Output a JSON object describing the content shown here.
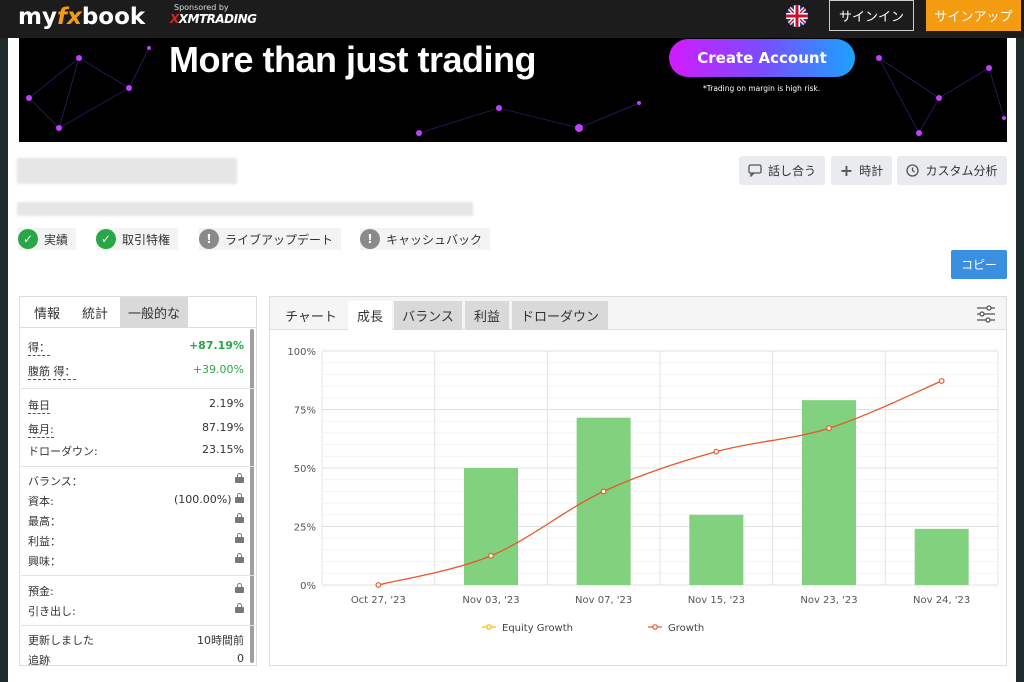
{
  "topbar": {
    "logo_pre": "my",
    "logo_fx": "fx",
    "logo_post": "book",
    "sponsor_label": "Sponsored by",
    "sponsor_brand_x": "X",
    "sponsor_brand": "XMTRADING",
    "signin": "サインイン",
    "signup": "サインアップ"
  },
  "banner": {
    "title": "More than just trading",
    "cta": "Create Account",
    "risk": "*Trading on margin is high risk."
  },
  "actions": {
    "discuss": "話し合う",
    "watch": "時計",
    "custom": "カスタム分析",
    "copy": "コピー"
  },
  "badges": [
    {
      "label": "実績",
      "status": "ok"
    },
    {
      "label": "取引特権",
      "status": "ok"
    },
    {
      "label": "ライブアップデート",
      "status": "warn"
    },
    {
      "label": "キャッシュバック",
      "status": "warn"
    }
  ],
  "stats_tabs": [
    "情報",
    "統計",
    "一般的な"
  ],
  "stats": {
    "gain_label": "得：",
    "gain": "+87.19%",
    "abs_gain_label": "腹筋 得：",
    "abs_gain": "+39.00%",
    "daily_label": "毎日",
    "daily": "2.19%",
    "monthly_label": "毎月:",
    "monthly": "87.19%",
    "drawdown_label": "ドローダウン:",
    "drawdown": "23.15%",
    "balance_label": "バランス：",
    "equity_label": "資本:",
    "equity": "(100.00%)",
    "highest_label": "最高：",
    "profit_label": "利益：",
    "interest_label": "興味：",
    "deposits_label": "預金:",
    "withdrawals_label": "引き出し:",
    "updated_label": "更新しました",
    "updated": "10時間前",
    "tracking_label": "追跡",
    "tracking": "0"
  },
  "chart_tabs": [
    "チャート",
    "成長",
    "バランス",
    "利益",
    "ドローダウン"
  ],
  "chart_data": {
    "type": "bar",
    "categories": [
      "Oct 27, '23",
      "Nov 03, '23",
      "Nov 07, '23",
      "Nov 15, '23",
      "Nov 23, '23",
      "Nov 24, '23"
    ],
    "y_ticks": [
      "0%",
      "25%",
      "50%",
      "75%",
      "100%"
    ],
    "ylim": [
      0,
      100
    ],
    "series": [
      {
        "name": "Equity Growth",
        "type": "line",
        "color": "#f5b800",
        "values": []
      },
      {
        "name": "Growth",
        "type": "line",
        "color": "#e8562a",
        "values": [
          0,
          12.5,
          40,
          57,
          67,
          87.19
        ]
      },
      {
        "type": "bar",
        "color": "#82d17f",
        "values": [
          0,
          50,
          71.5,
          30,
          79,
          24
        ]
      }
    ],
    "grid": true,
    "legend": "bottom"
  }
}
